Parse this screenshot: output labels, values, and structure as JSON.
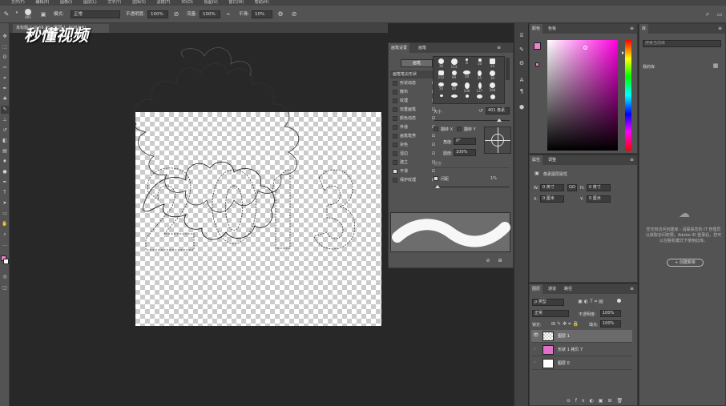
{
  "menubar": {
    "items": [
      "文件(F)",
      "编辑(E)",
      "图像(I)",
      "图层(L)",
      "文字(Y)",
      "选择(S)",
      "滤镜(T)",
      "3D(D)",
      "视图(V)",
      "窗口(W)",
      "帮助(H)"
    ]
  },
  "options": {
    "brush_size": "401",
    "mode_label": "模式:",
    "mode_value": "正常",
    "opacity_label": "不透明度:",
    "opacity_value": "100%",
    "flow_label": "流量:",
    "flow_value": "100%",
    "smooth_label": "平滑:",
    "smooth_value": "10%"
  },
  "document": {
    "tab_title": "未标题-1 @ 66.7% (图层 1, RGB/8#)"
  },
  "watermark": {
    "text": "秒懂视频"
  },
  "brush_panel": {
    "tabs": [
      "画笔设置",
      "画笔"
    ],
    "preset_button": "画笔",
    "items": [
      {
        "label": "画笔笔尖形状",
        "checked": null,
        "selected": true
      },
      {
        "label": "形状动态",
        "checked": false
      },
      {
        "label": "散布",
        "checked": false
      },
      {
        "label": "纹理",
        "checked": false
      },
      {
        "label": "双重画笔",
        "checked": false
      },
      {
        "label": "颜色动态",
        "checked": false
      },
      {
        "label": "传递",
        "checked": false
      },
      {
        "label": "画笔笔势",
        "checked": false
      },
      {
        "label": "杂色",
        "checked": false
      },
      {
        "label": "湿边",
        "checked": false
      },
      {
        "label": "建立",
        "checked": false
      },
      {
        "label": "平滑",
        "checked": true
      },
      {
        "label": "保护纹理",
        "checked": false
      }
    ],
    "tips": [
      "30",
      "123",
      "8",
      "10",
      "25",
      "112",
      "60",
      "50",
      "25",
      "30",
      "50",
      "60",
      "100",
      "127",
      "284",
      "80",
      "174",
      "175",
      "306",
      "50"
    ],
    "size_label": "大小",
    "size_value": "401 像素",
    "flip_x": "翻转 X",
    "flip_y": "翻转 Y",
    "angle_label": "角度:",
    "angle_value": "0°",
    "roundness_label": "圆度:",
    "roundness_value": "100%",
    "hardness_label": "硬度",
    "spacing_label": "间距",
    "spacing_value": "1%"
  },
  "color_panel": {
    "tabs": [
      "颜色",
      "色板"
    ],
    "fg_color": "#f080d0",
    "bg_color": "#ffffff"
  },
  "properties_panel": {
    "tabs": [
      "属性",
      "调整"
    ],
    "title": "像素图层属性",
    "w_label": "W:",
    "w_value": "0 英寸",
    "link": "GO",
    "h_label": "H:",
    "h_value": "0 英寸",
    "x_label": "X:",
    "x_value": "0 厘米",
    "y_label": "Y:",
    "y_value": "0 厘米"
  },
  "layers_panel": {
    "tabs": [
      "图层",
      "通道",
      "路径"
    ],
    "filter_label": "ρ 类型",
    "blend_value": "正常",
    "opacity_label": "不透明度:",
    "opacity_value": "100%",
    "lock_label": "锁定:",
    "fill_label": "填充:",
    "fill_value": "100%",
    "layers": [
      {
        "name": "图层 1",
        "selected": true,
        "visible": true,
        "thumb": "transparent"
      },
      {
        "name": "形状 1 拷贝 7",
        "selected": false,
        "visible": false,
        "thumb": "pink"
      },
      {
        "name": "图层 0",
        "selected": false,
        "visible": false,
        "thumb": "white"
      }
    ]
  },
  "library_panel": {
    "tab": "库",
    "search_placeholder": "搜索当前库",
    "library_name": "我的库",
    "info": "您无权访问创建库 - 请联系您的 IT 管理员以获取访问权限。Adobe ID 登录后，您可以在脱机模式下使用此库。",
    "create_button": "+ 创建新库"
  }
}
